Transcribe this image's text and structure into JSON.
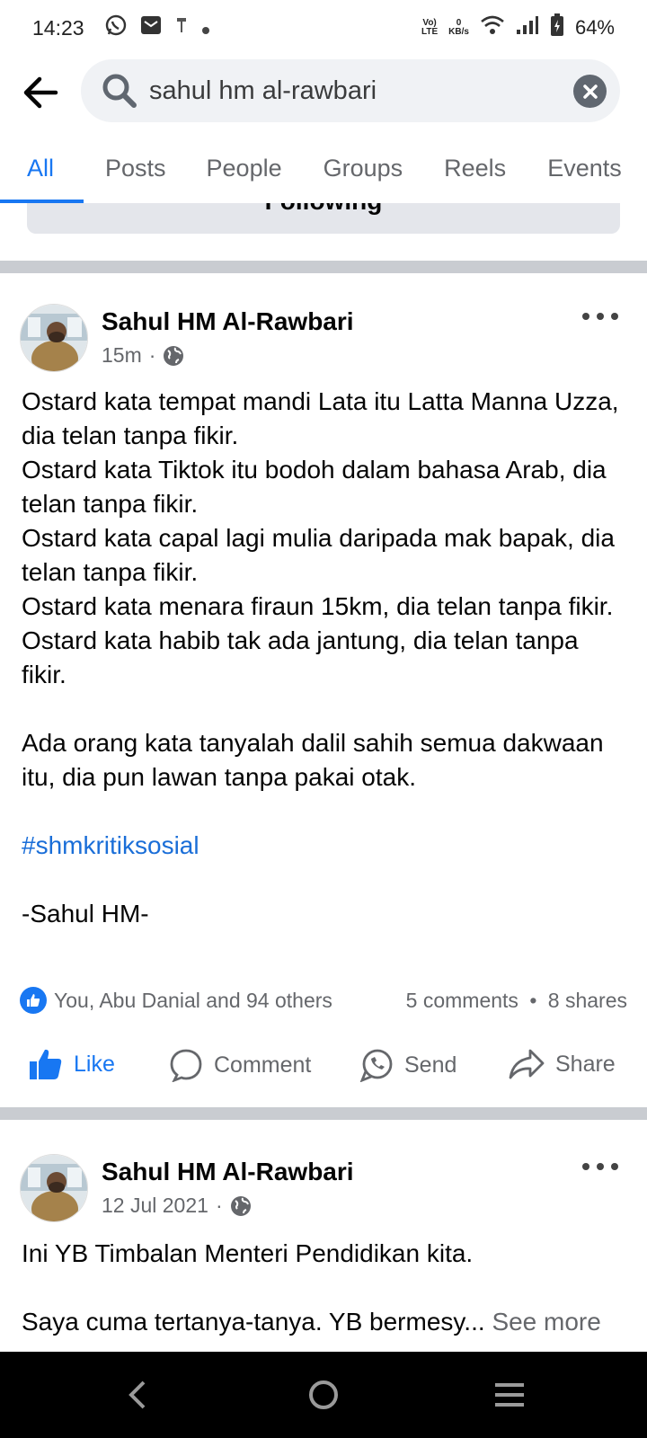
{
  "status_bar": {
    "time": "14:23",
    "lte_top": "Vo)",
    "lte_bottom": "LTE",
    "speed_top": "0",
    "speed_bottom": "KB/s",
    "battery": "64%"
  },
  "search": {
    "query": "sahul hm al-rawbari",
    "back_icon": "arrow-left-icon",
    "search_icon": "search-icon",
    "clear_icon": "close-icon"
  },
  "tabs": [
    {
      "label": "All",
      "active": true
    },
    {
      "label": "Posts"
    },
    {
      "label": "People"
    },
    {
      "label": "Groups"
    },
    {
      "label": "Reels"
    },
    {
      "label": "Events"
    }
  ],
  "following_button": "Following",
  "post1": {
    "author": "Sahul HM Al-Rawbari",
    "time": "15m",
    "separator": "·",
    "lines": [
      "Ostard kata tempat mandi Lata itu Latta Manna Uzza, dia telan tanpa fikir.",
      "Ostard kata Tiktok itu bodoh dalam bahasa Arab, dia telan tanpa fikir.",
      "Ostard kata capal lagi mulia daripada mak bapak, dia telan tanpa fikir.",
      "Ostard kata menara firaun 15km, dia telan tanpa fikir.",
      "Ostard kata habib tak ada jantung, dia telan tanpa fikir.",
      "",
      "Ada orang kata tanyalah dalil sahih semua dakwaan itu, dia pun lawan tanpa pakai otak.",
      ""
    ],
    "hashtag": "#shmkritiksosial",
    "signature": "-Sahul HM-",
    "reactions": "You, Abu Danial and 94 others",
    "comments": "5 comments",
    "dot": "•",
    "shares": "8 shares",
    "actions": {
      "like": "Like",
      "comment": "Comment",
      "send": "Send",
      "share": "Share"
    }
  },
  "post2": {
    "author": "Sahul HM Al-Rawbari",
    "time": "12 Jul 2021",
    "separator": "·",
    "line1": "Ini YB Timbalan Menteri Pendidikan kita.",
    "line2": "Saya cuma tertanya-tanya. YB bermesy...",
    "see_more": "See more"
  },
  "colors": {
    "accent": "#1877f2",
    "hashtag": "#1a6ed8",
    "secondary_text": "#65676b",
    "divider": "#c9ccd1"
  }
}
